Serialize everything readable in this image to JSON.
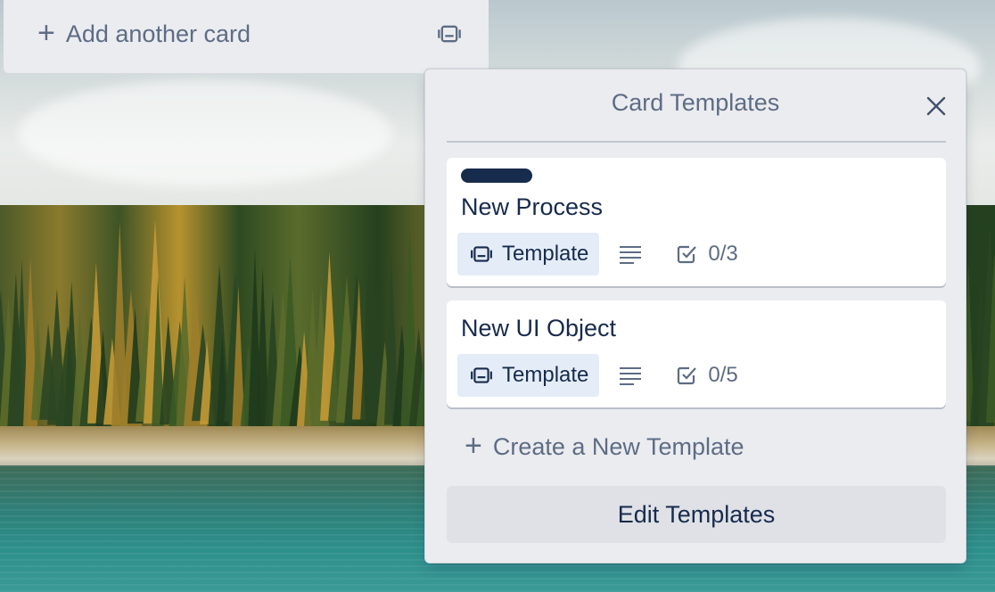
{
  "list_footer": {
    "add_card_label": "Add another card",
    "add_card_icon": "plus-icon",
    "template_toggle_icon": "card-template-icon"
  },
  "popover": {
    "title": "Card Templates",
    "close_icon": "close-icon",
    "templates": [
      {
        "label_color": "#172b4d",
        "title": "New Process",
        "badge_label": "Template",
        "checklist": "0/3"
      },
      {
        "title": "New UI Object",
        "badge_label": "Template",
        "checklist": "0/5"
      }
    ],
    "create_label": "Create a New Template",
    "edit_label": "Edit Templates"
  },
  "colors": {
    "accent": "#172b4d",
    "muted": "#5e6c84",
    "panel": "#ebecf0",
    "badge_bg": "#e4ecf7"
  }
}
